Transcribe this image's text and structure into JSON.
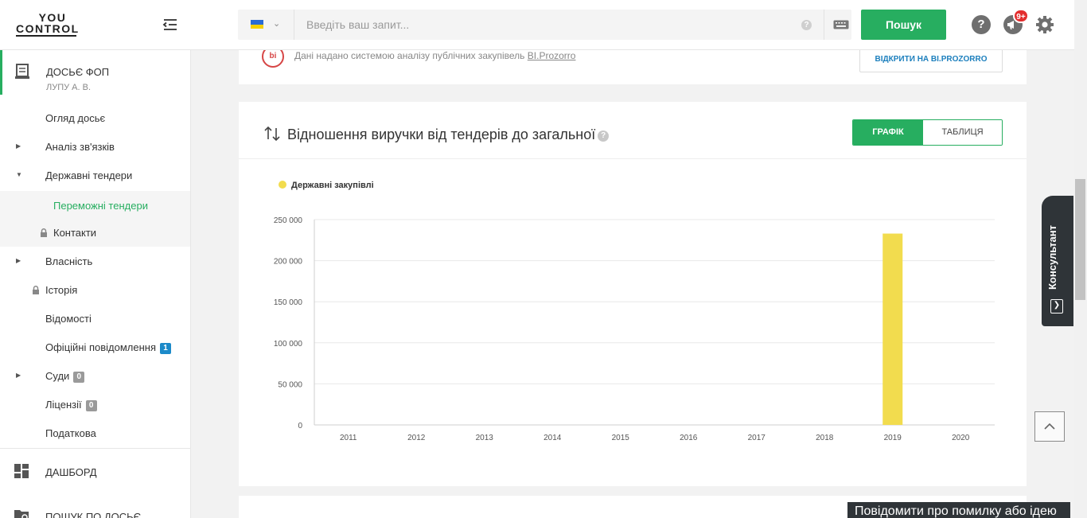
{
  "brand": {
    "logo_line1": "YOU",
    "logo_line2": "CONTROL"
  },
  "search": {
    "placeholder": "Введіть ваш запит...",
    "button_label": "Пошук",
    "lang_flag": "ukraine-flag-icon"
  },
  "header_icons": {
    "notifications_badge": "9+",
    "help": "?"
  },
  "sidebar": {
    "dossier_title": "ДОСЬЄ ФОП",
    "dossier_subtitle": "ЛУПУ А. В.",
    "items": [
      {
        "label": "Огляд досьє"
      },
      {
        "label": "Аналіз зв'язків"
      },
      {
        "label": "Державні тендери"
      },
      {
        "label": "Переможні тендери"
      },
      {
        "label": "Контакти"
      },
      {
        "label": "Власність"
      },
      {
        "label": "Історія"
      },
      {
        "label": "Відомості"
      },
      {
        "label": "Офіційні повідомлення",
        "badge": "1"
      },
      {
        "label": "Суди",
        "badge": "0"
      },
      {
        "label": "Ліцензії",
        "badge": "0"
      },
      {
        "label": "Податкова"
      }
    ],
    "dashboard": "ДАШБОРД",
    "search_dossier": "ПОШУК ПО ДОСЬЄ"
  },
  "bi_card": {
    "logo": "bi",
    "text_prefix": "Дані надано системою аналізу публічних закупівель",
    "link": "BI.Prozorro",
    "button": "ВІДКРИТИ НА BI.PROZORRO"
  },
  "chart_card": {
    "title": "Відношення виручки від тендерів до загальної",
    "help": "?",
    "toggle_on": "ГРАФІК",
    "toggle_off": "ТАБЛИЦЯ",
    "legend": "Державні закупівлі"
  },
  "chart_data": {
    "type": "bar",
    "categories": [
      "2011",
      "2012",
      "2013",
      "2014",
      "2015",
      "2016",
      "2017",
      "2018",
      "2019",
      "2020"
    ],
    "series": [
      {
        "name": "Державні закупівлі",
        "values": [
          0,
          0,
          0,
          0,
          0,
          0,
          0,
          0,
          233000,
          0
        ],
        "color": "#f2dc4e"
      }
    ],
    "yticks": [
      "0",
      "50 000",
      "100 000",
      "150 000",
      "200 000",
      "250 000"
    ],
    "ylim": [
      0,
      250000
    ],
    "grid": true,
    "legend_position": "top-left"
  },
  "widgets": {
    "consultant": "Консультант",
    "report": "Повідомити про помилку або ідею"
  }
}
